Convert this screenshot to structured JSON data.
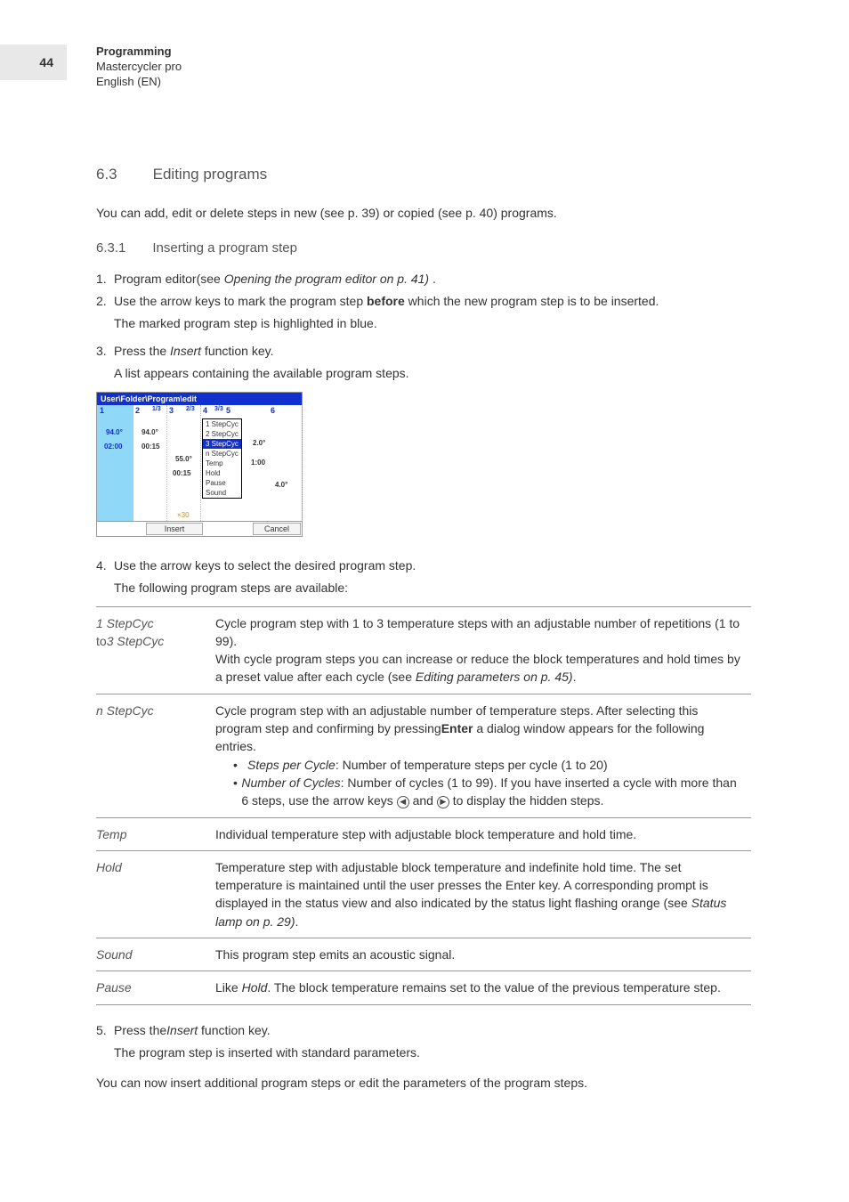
{
  "page_number": "44",
  "header": {
    "title": "Programming",
    "product": "Mastercycler pro",
    "language": "English (EN)"
  },
  "section": {
    "number": "6.3",
    "title": "Editing programs"
  },
  "intro": "You can add, edit or delete steps in new (see p. 39) or copied (see p. 40) programs.",
  "subsection": {
    "number": "6.3.1",
    "title": "Inserting a program step"
  },
  "step1": {
    "num": "1.",
    "text_a": "Program editor(see ",
    "text_b_italic": "Opening the program editor on p. 41)",
    "text_c": " ."
  },
  "step2": {
    "num": "2.",
    "text_a": "Use the arrow keys to mark the program step ",
    "bold": "before",
    "text_b": " which the new program step is to be inserted.",
    "sub": "The marked program step is highlighted in blue."
  },
  "step3": {
    "num": "3.",
    "text_a": "Press the ",
    "italic": "Insert",
    "text_b": " function key.",
    "sub": "A list appears containing the available program steps."
  },
  "screenshot": {
    "title": "User\\Folder\\Program\\edit",
    "cols": {
      "c1": "1",
      "c2": "2",
      "c2s": "1/3",
      "c3": "3",
      "c3s": "2/3",
      "c4": "4",
      "c5": "5",
      "c5s": "3/3",
      "c6": "6"
    },
    "temps": {
      "t1": "94.0°",
      "t2": "94.0°",
      "t3": "55.0°",
      "t6a": "2.0°",
      "t6b": "4.0°"
    },
    "times": {
      "d1": "02:00",
      "d2": "00:15",
      "d3": "00:15",
      "d6": "1:00"
    },
    "cycle": "×30",
    "menu": [
      "1 StepCyc",
      "2 StepCyc",
      "3 StepCyc",
      "n StepCyc",
      "Temp",
      "Hold",
      "Pause",
      "Sound"
    ],
    "selected_index": 2,
    "buttons": {
      "insert": "Insert",
      "cancel": "Cancel"
    }
  },
  "step4": {
    "num": "4.",
    "text": "Use the arrow keys to select the desired program step.",
    "sub": "The following program steps are available:"
  },
  "table": {
    "row1": {
      "term_a": "1 StepCyc",
      "term_b": "to",
      "term_c": "3 StepCyc",
      "line1": "Cycle program step with 1 to 3 temperature steps with an adjustable number of repetitions (1 to 99).",
      "line2a": "With cycle program steps you can increase or reduce the block temperatures and hold times by a preset value after each cycle (see ",
      "line2b_italic": "Editing parameters on p. 45)",
      "line2c": "."
    },
    "row2": {
      "term": "n StepCyc",
      "line1a": "Cycle program step with an adjustable number of temperature steps. After selecting this program step and confirming by pressing",
      "line1b_bold": "Enter",
      "line1c": " a dialog window appears for the following entries.",
      "bullet1_a_italic": "Steps per Cycle",
      "bullet1_b": ": Number of temperature steps per cycle (1 to 20)",
      "bullet2_a_italic": "Number of Cycles",
      "bullet2_b": ": Number of cycles (1 to 99). If you have inserted a cycle with more than 6 steps, use the arrow keys ",
      "bullet2_c": " and ",
      "bullet2_d": " to display the hidden steps."
    },
    "row3": {
      "term": "Temp",
      "text": "Individual temperature step with adjustable block temperature and hold time."
    },
    "row4": {
      "term": "Hold",
      "text_a": "Temperature step with adjustable block temperature and indefinite hold time. The set temperature is maintained until the user presses the Enter key. A corresponding prompt is displayed in the status view and also indicated by the status light flashing orange (see ",
      "text_b_italic": "Status lamp on p. 29)",
      "text_c": "."
    },
    "row5": {
      "term": "Sound",
      "text": "This program step emits an acoustic signal."
    },
    "row6": {
      "term": "Pause",
      "text_a": "Like ",
      "text_b_italic": "Hold",
      "text_c": ". The block temperature remains set to the value of the previous temperature step."
    }
  },
  "step5": {
    "num": "5.",
    "text_a": "Press the",
    "italic": "Insert",
    "text_b": " function key.",
    "sub": "The program step is inserted with standard parameters."
  },
  "outro": "You can now insert additional program steps or edit the parameters of the program steps."
}
